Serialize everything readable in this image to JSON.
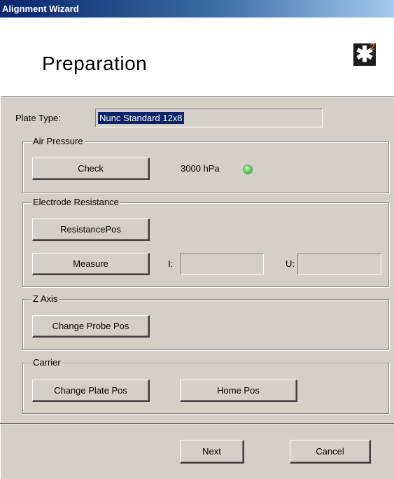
{
  "window": {
    "title": "Alignment Wizard"
  },
  "header": {
    "title": "Preparation",
    "logo": {
      "symbol": "✱",
      "superscript": "2"
    }
  },
  "plate_type": {
    "label": "Plate Type:",
    "value": "Nunc Standard 12x8"
  },
  "air_pressure": {
    "title": "Air Pressure",
    "check_label": "Check",
    "value": "3000 hPa",
    "led_color": "#5cd65c"
  },
  "electrode": {
    "title": "Electrode Resistance",
    "resistance_pos_label": "ResistancePos",
    "measure_label": "Measure",
    "i_label": "I:",
    "i_value": "",
    "u_label": "U:",
    "u_value": ""
  },
  "z_axis": {
    "title": "Z Axis",
    "change_probe_label": "Change Probe Pos"
  },
  "carrier": {
    "title": "Carrier",
    "change_plate_label": "Change Plate Pos",
    "home_pos_label": "Home Pos"
  },
  "footer": {
    "next_label": "Next",
    "cancel_label": "Cancel"
  }
}
